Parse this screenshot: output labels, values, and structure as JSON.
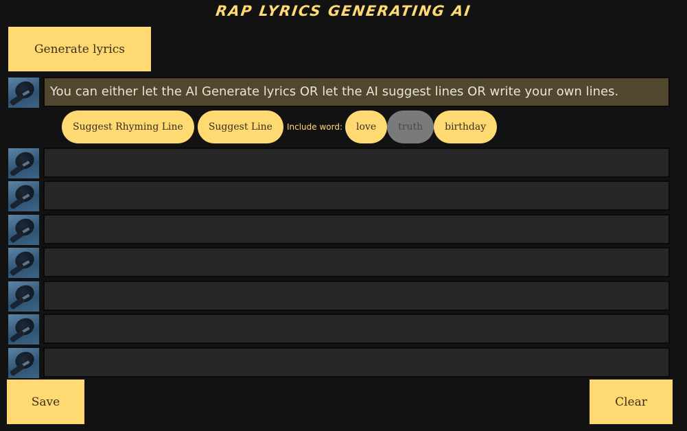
{
  "app": {
    "title": "RAP LYRICS GENERATING AI"
  },
  "toolbar": {
    "generate_label": "Generate lyrics"
  },
  "lines": [
    {
      "value": "You can either let the AI Generate lyrics OR let the AI suggest lines OR write your own lines.",
      "avatar": "microphone-icon"
    },
    {
      "value": "",
      "avatar": "microphone-icon"
    },
    {
      "value": "",
      "avatar": "microphone-icon"
    },
    {
      "value": "",
      "avatar": "microphone-icon"
    },
    {
      "value": "",
      "avatar": "microphone-icon"
    },
    {
      "value": "",
      "avatar": "microphone-icon"
    },
    {
      "value": "",
      "avatar": "microphone-icon"
    },
    {
      "value": "",
      "avatar": "microphone-icon"
    }
  ],
  "suggestions": {
    "rhyming_label": "Suggest Rhyming Line",
    "line_label": "Suggest Line",
    "include_label": "Include word:",
    "words": [
      {
        "label": "love",
        "selected": true
      },
      {
        "label": "truth",
        "selected": false
      },
      {
        "label": "birthday",
        "selected": true
      }
    ]
  },
  "footer": {
    "save_label": "Save",
    "clear_label": "Clear"
  },
  "colors": {
    "accent": "#ffd972",
    "background": "#121212",
    "line_bg": "#272727",
    "first_line_bg": "#51472f",
    "inactive": "#7a7a7a"
  }
}
